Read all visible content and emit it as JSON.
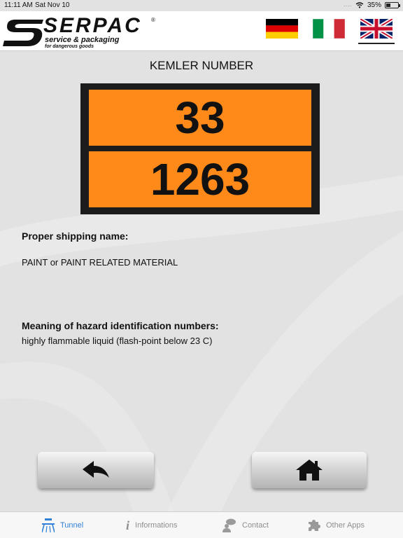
{
  "status_bar": {
    "time": "11:11 AM",
    "date": "Sat Nov 10",
    "signal": "....",
    "battery": "35%",
    "battery_level": 0.35
  },
  "header": {
    "logo": {
      "brand": "SERPAC",
      "registered": "®",
      "tagline": "service & packaging",
      "subtagline": "for dangerous goods"
    },
    "languages": [
      {
        "name": "German",
        "icon": "germany-flag-icon"
      },
      {
        "name": "Italian",
        "icon": "italy-flag-icon"
      },
      {
        "name": "English",
        "icon": "uk-flag-icon",
        "selected": true
      }
    ]
  },
  "page": {
    "title": "KEMLER NUMBER"
  },
  "plate": {
    "hazard_number": "33",
    "un_number": "1263",
    "colors": {
      "border": "#1c1c1c",
      "panel": "#ff8a1a"
    }
  },
  "info": {
    "shipping_name_label": "Proper shipping name:",
    "shipping_name_value": "PAINT or PAINT RELATED MATERIAL",
    "hazard_meaning_label": "Meaning of hazard identification numbers:",
    "hazard_meaning_value": "highly flammable liquid (flash-point below 23 C)"
  },
  "buttons": {
    "back_icon": "back-arrow-icon",
    "home_icon": "home-icon"
  },
  "tab_bar": {
    "tabs": [
      {
        "label": "Tunnel",
        "icon": "tunnel-icon",
        "active": true
      },
      {
        "label": "Informations",
        "icon": "info-icon"
      },
      {
        "label": "Contact",
        "icon": "contact-icon"
      },
      {
        "label": "Other Apps",
        "icon": "puzzle-icon"
      }
    ],
    "active_color": "#2f7fd8",
    "inactive_color": "#8e8e8e"
  }
}
